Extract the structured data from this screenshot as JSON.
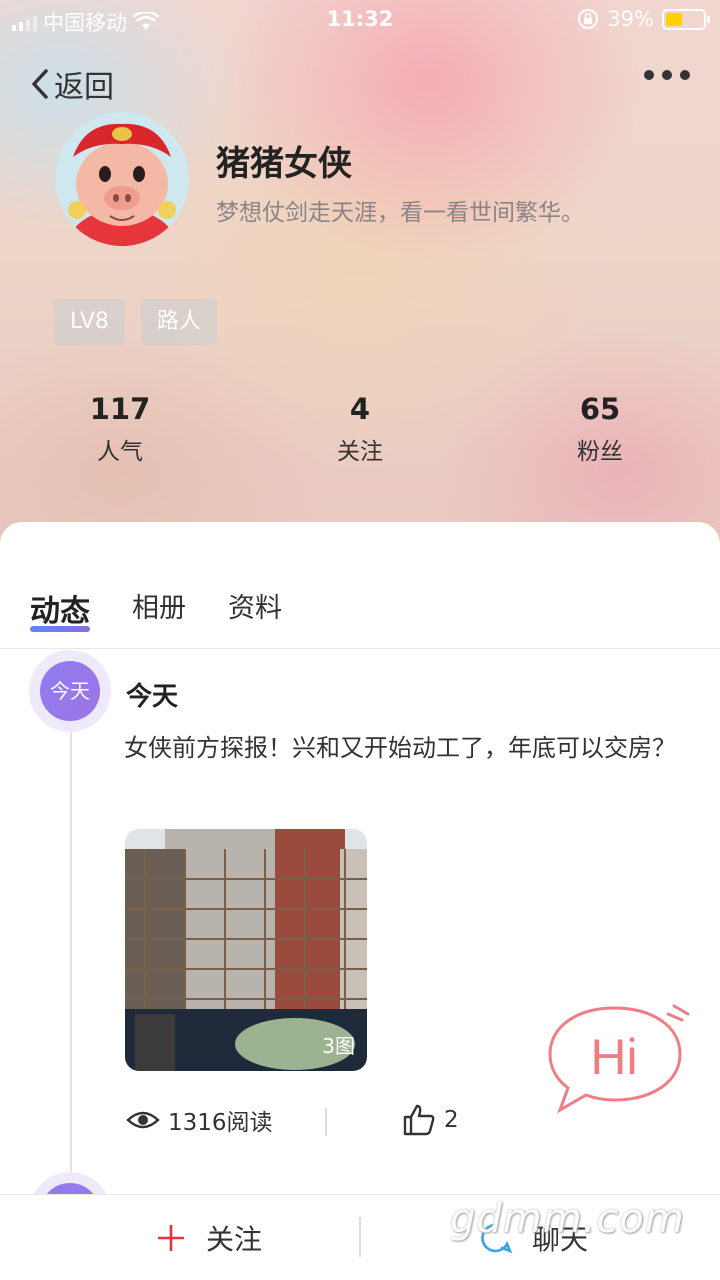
{
  "status_bar": {
    "carrier": "中国移动",
    "time": "11:32",
    "battery": "39%"
  },
  "nav": {
    "back_label": "返回"
  },
  "profile": {
    "name": "猪猪女侠",
    "bio": "梦想仗剑走天涯，看一看世间繁华。",
    "tags": [
      "LV8",
      "路人"
    ],
    "stats": [
      {
        "value": "117",
        "label": "人气"
      },
      {
        "value": "4",
        "label": "关注"
      },
      {
        "value": "65",
        "label": "粉丝"
      }
    ]
  },
  "tabs": [
    {
      "label": "动态",
      "active": true
    },
    {
      "label": "相册",
      "active": false
    },
    {
      "label": "资料",
      "active": false
    }
  ],
  "post": {
    "badge": "今天",
    "date": "今天",
    "text": "女侠前方探报！兴和又开始动工了，年底可以交房？",
    "image_count": "3图",
    "reads": "1316阅读",
    "likes": "2"
  },
  "hi_bubble": {
    "text": "Hi"
  },
  "bottom_bar": {
    "follow_label": "关注",
    "chat_label": "聊天"
  },
  "watermark": "gdmm.com",
  "colors": {
    "accent": "#8f7cf0",
    "follow_plus": "#e8323c",
    "chat_icon": "#3aa0e8",
    "hi_pink": "#f07c84"
  }
}
